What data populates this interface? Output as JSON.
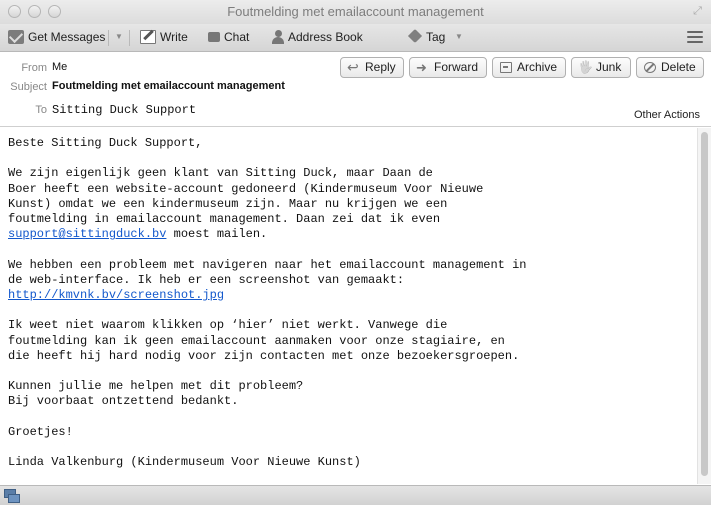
{
  "window": {
    "title": "Foutmelding met emailaccount management"
  },
  "toolbar": {
    "get_messages": "Get Messages",
    "write": "Write",
    "chat": "Chat",
    "address_book": "Address Book",
    "tag": "Tag"
  },
  "header": {
    "from_label": "From",
    "from_value": "Me",
    "subject_label": "Subject",
    "subject_value": "Foutmelding met emailaccount management",
    "to_label": "To",
    "to_value": "Sitting Duck Support",
    "other_actions": "Other Actions"
  },
  "actions": {
    "reply": "Reply",
    "forward": "Forward",
    "archive": "Archive",
    "junk": "Junk",
    "delete": "Delete"
  },
  "message": {
    "greeting": "Beste Sitting Duck Support,",
    "p1_lines": [
      "We zijn eigenlijk geen klant van Sitting Duck, maar Daan de",
      "Boer heeft een website-account gedoneerd (Kindermuseum Voor Nieuwe",
      "Kunst) omdat we een kindermuseum zijn. Maar nu krijgen we een",
      "foutmelding in emailaccount management. Daan zei dat ik even"
    ],
    "p1_link": "support@sittingduck.bv",
    "p1_tail": " moest mailen.",
    "p2_lines": [
      "We hebben een probleem met navigeren naar het emailaccount management in",
      "de web-interface. Ik heb er een screenshot van gemaakt:"
    ],
    "p2_link": "http://kmvnk.bv/screenshot.jpg",
    "p3_lines": [
      "Ik weet niet waarom klikken op ‘hier’ niet werkt. Vanwege die",
      "foutmelding kan ik geen emailaccount aanmaken voor onze stagiaire, en",
      "die heeft hij hard nodig voor zijn contacten met onze bezoekersgroepen."
    ],
    "p4_lines": [
      "Kunnen jullie me helpen met dit probleem?",
      "Bij voorbaat ontzettend bedankt."
    ],
    "closing": "Groetjes!",
    "signature": "Linda Valkenburg (Kindermuseum Voor Nieuwe Kunst)"
  },
  "icons": {
    "get_messages": "mail-download-icon",
    "write": "compose-icon",
    "chat": "chat-bubble-icon",
    "address_book": "person-icon",
    "tag": "tag-icon",
    "menu": "hamburger-menu-icon",
    "status": "network-status-icon"
  },
  "colors": {
    "link": "#1358cc"
  }
}
